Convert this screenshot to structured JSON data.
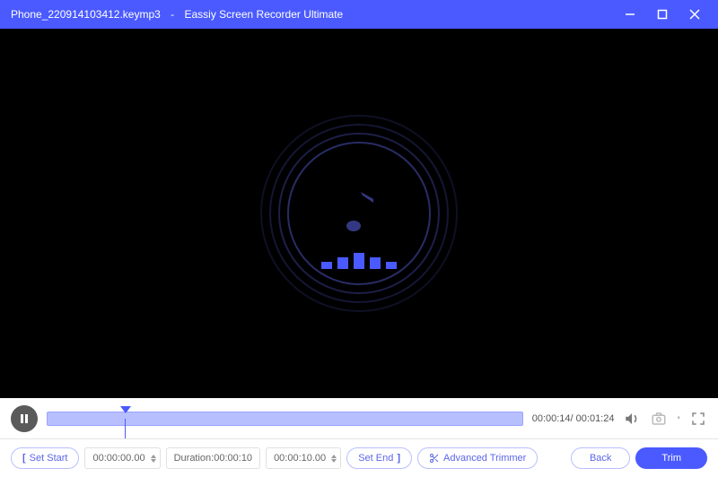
{
  "titlebar": {
    "filename": "Phone_220914103412.keymp3",
    "separator": "-",
    "app_name": "Eassiy Screen Recorder Ultimate"
  },
  "playback": {
    "current_time": "00:00:14",
    "total_time": "00:01:24"
  },
  "trim": {
    "set_start_label": "Set Start",
    "start_time": "00:00:00.00",
    "duration_label": "Duration:",
    "duration_value": "00:00:10",
    "end_time": "00:00:10.00",
    "set_end_label": "Set End",
    "advanced_label": "Advanced Trimmer",
    "back_label": "Back",
    "trim_label": "Trim"
  }
}
